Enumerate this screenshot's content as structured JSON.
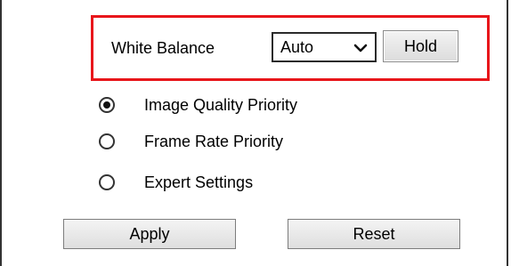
{
  "white_balance": {
    "label": "White Balance",
    "mode_select": {
      "selected": "Auto"
    },
    "hold_label": "Hold"
  },
  "priority_options": [
    {
      "label": "Image Quality Priority",
      "checked": true
    },
    {
      "label": "Frame Rate Priority",
      "checked": false
    },
    {
      "label": "Expert Settings",
      "checked": false
    }
  ],
  "actions": {
    "apply_label": "Apply",
    "reset_label": "Reset"
  },
  "colors": {
    "highlight_border": "#e8161b"
  }
}
